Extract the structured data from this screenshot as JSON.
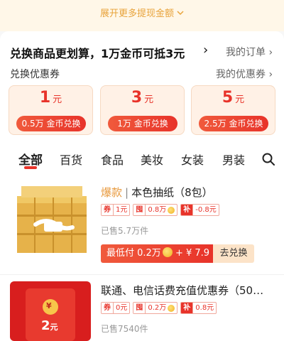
{
  "expand_link": {
    "label": "展开更多提现金额"
  },
  "promo": {
    "title": "兑换商品更划算，1万金币可抵3元",
    "orders_link": "我的订单 ›"
  },
  "coupons_section": {
    "label": "兑换优惠券",
    "my_coupons_link": "我的优惠券 ›",
    "coupons": [
      {
        "amount": "1",
        "unit": "元",
        "button": "0.5万 金币兑换"
      },
      {
        "amount": "3",
        "unit": "元",
        "button": "1万 金币兑换"
      },
      {
        "amount": "5",
        "unit": "元",
        "button": "2.5万 金币兑换"
      }
    ]
  },
  "tabs": [
    "全部",
    "百货",
    "食品",
    "美妆",
    "女装",
    "男装"
  ],
  "active_tab": "全部",
  "products": [
    {
      "hot": "爆款",
      "separator": "|",
      "name": "本色抽纸（8包）",
      "tags": [
        {
          "k": "券",
          "v": "1元"
        },
        {
          "k": "囤",
          "v": "0.8万"
        },
        {
          "k": "补",
          "v": "-0.8元"
        }
      ],
      "sold": "已售5.7万件",
      "cta_left": "最低付 0.2万",
      "cta_price": "+ ¥ 7.9",
      "cta_right": "去兑换"
    },
    {
      "name": "联通、电信话费充值优惠券（50…",
      "image_symbol": "¥",
      "image_amount": "2",
      "image_unit": "元",
      "tags": [
        {
          "k": "券",
          "v": "0元"
        },
        {
          "k": "囤",
          "v": "0.2万"
        },
        {
          "k": "补",
          "v": "0.8元"
        }
      ],
      "sold": "已售7540件"
    }
  ],
  "colors": {
    "accent": "#e8332a",
    "gold": "#e8a33a",
    "coupon_bg": "#fff1e6"
  }
}
